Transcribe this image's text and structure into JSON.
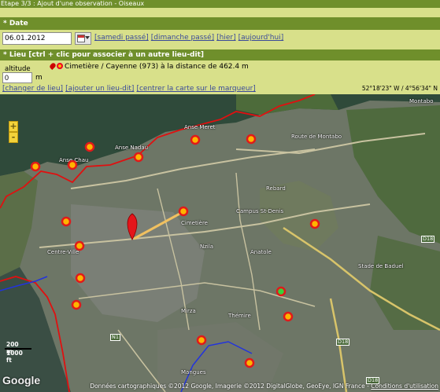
{
  "step_title": "Etape 3/3 : Ajout d'une observation - Oiseaux",
  "date_section": {
    "header": "* Date",
    "date_value": "06.01.2012",
    "links": [
      "[samedi passé]",
      "[dimanche passé]",
      "[hier]",
      "[aujourd'hui]"
    ]
  },
  "lieu_section": {
    "header": "* Lieu [ctrl + clic pour associer à un autre lieu-dit]",
    "altitude_label": "altitude",
    "altitude_value": "0",
    "altitude_unit": "m",
    "place_text": "Cimetière / Cayenne (973) à la distance de 462.4 m",
    "coordinates": "52°18'23\" W / 4°56'34\" N",
    "links": [
      "[changer de lieu]",
      "[ajouter un lieu-dit]",
      "[centrer la carte sur le marqueur]"
    ]
  },
  "map": {
    "zoom_in": "+",
    "zoom_out": "-",
    "scale_m": "200 m",
    "scale_ft": "1000 ft",
    "google_logo": "Google",
    "attribution_prefix": "Données cartographiques ©2012 Google, Imagerie ©2012 DigitalGlobe, GeoEye, IGN France - ",
    "attribution_link": "Conditions d'utilisation",
    "labels": {
      "anse_meret": "Anse Meret",
      "anse_nadau": "Anse Nadau",
      "anse_chau": "Anse Chau",
      "route_montabo": "Route de Montabo",
      "montabo": "Montabo",
      "campus": "Campus\nSt-Denis",
      "cimetiere": "Cimetière",
      "rebard": "Rebard",
      "anatole": "Anatole",
      "nzila": "Nzila",
      "centre_ville": "Centre-Ville",
      "stade": "Stade de\nBaduel",
      "themire": "Thémire",
      "mirza": "Mirza",
      "mangues": "Mangues",
      "d18a": "D18",
      "d18b": "D18",
      "d18c": "D18",
      "n1": "N1"
    }
  }
}
